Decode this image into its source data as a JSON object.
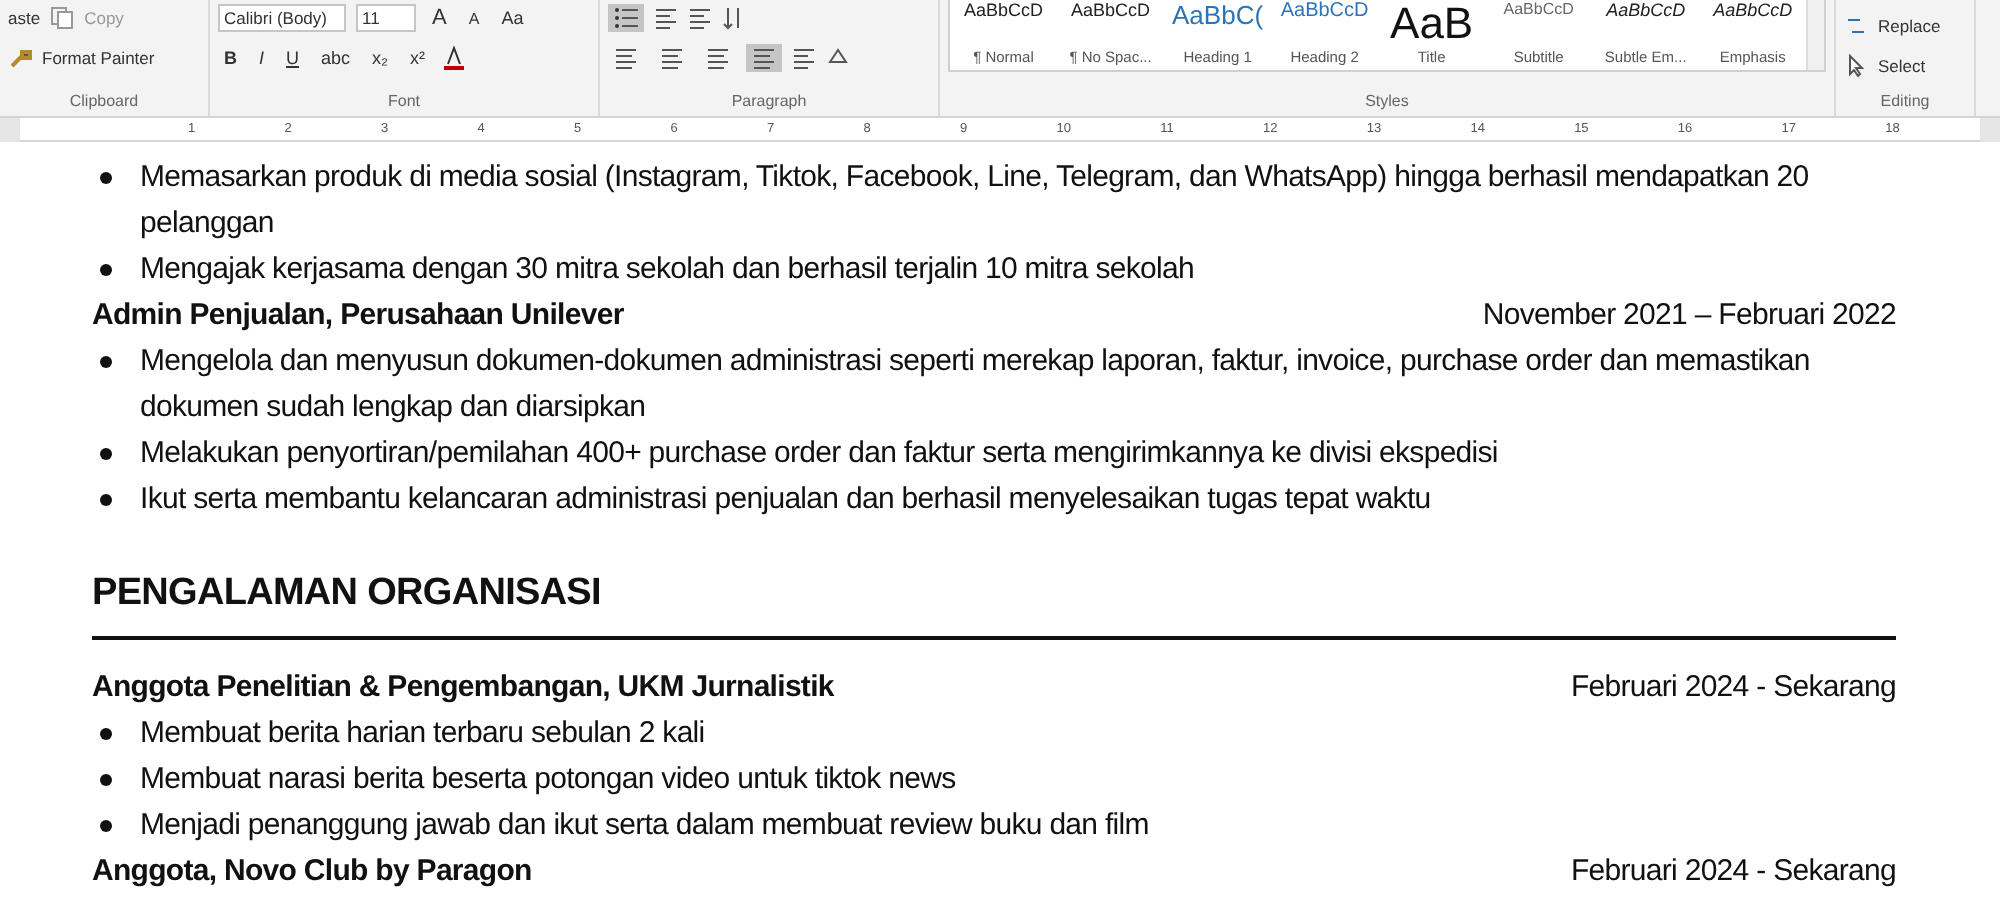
{
  "ribbon": {
    "clipboard": {
      "paste_label": "aste",
      "items": [
        "Copy",
        "Format Painter"
      ],
      "label": "Clipboard"
    },
    "font": {
      "font_name": "Calibri (Body)",
      "font_size": "11",
      "grow": "A",
      "shrink": "A",
      "case": "Aa",
      "buttons": [
        "B",
        "I",
        "U",
        "abc",
        "x₂",
        "x²"
      ],
      "label": "Font"
    },
    "paragraph": {
      "align": [
        {
          "selected": false
        },
        {
          "selected": false
        },
        {
          "selected": false
        },
        {
          "selected": true
        }
      ],
      "bullets_selected": true,
      "label": "Paragraph"
    },
    "styles": {
      "items": [
        {
          "preview": "AaBbCcD",
          "name": "¶ Normal",
          "kind": "plain"
        },
        {
          "preview": "AaBbCcD",
          "name": "¶ No Spac...",
          "kind": "plain"
        },
        {
          "preview": "AaBbC(",
          "name": "Heading 1",
          "kind": "heading1"
        },
        {
          "preview": "AaBbCcD",
          "name": "Heading 2",
          "kind": "heading2"
        },
        {
          "preview": "AaB",
          "name": "Title",
          "kind": "title"
        },
        {
          "preview": "AaBbCcD",
          "name": "Subtitle",
          "kind": "subtitle"
        },
        {
          "preview": "AaBbCcD",
          "name": "Subtle Em...",
          "kind": "italic"
        },
        {
          "preview": "AaBbCcD",
          "name": "Emphasis",
          "kind": "italic"
        }
      ],
      "label": "Styles"
    },
    "editing": {
      "items": [
        "Replace",
        "Select"
      ],
      "label": "Editing"
    }
  },
  "ruler": [
    "1",
    "2",
    "3",
    "4",
    "5",
    "6",
    "7",
    "8",
    "9",
    "10",
    "11",
    "12",
    "13",
    "14",
    "15",
    "16",
    "17",
    "18"
  ],
  "document": [
    {
      "kind": "bullet",
      "text": "Memasarkan produk di media sosial (Instagram, Tiktok, Facebook, Line, Telegram, dan WhatsApp) hingga berhasil mendapatkan 20 pelanggan"
    },
    {
      "kind": "bullet",
      "text": "Mengajak kerjasama dengan 30 mitra sekolah dan berhasil terjalin 10 mitra sekolah"
    },
    {
      "kind": "entry",
      "title": "Admin Penjualan, Perusahaan Unilever",
      "date": "November 2021 – Februari 2022"
    },
    {
      "kind": "bullet",
      "text": "Mengelola dan menyusun dokumen-dokumen administrasi seperti merekap laporan, faktur, invoice, purchase order dan memastikan dokumen sudah lengkap dan diarsipkan"
    },
    {
      "kind": "bullet",
      "text": "Melakukan penyortiran/pemilahan 400+ purchase order dan faktur serta mengirimkannya ke divisi ekspedisi"
    },
    {
      "kind": "bullet",
      "text": "Ikut serta membantu kelancaran administrasi penjualan dan berhasil menyelesaikan tugas tepat waktu"
    },
    {
      "kind": "heading",
      "text": "PENGALAMAN ORGANISASI"
    },
    {
      "kind": "entry",
      "title": "Anggota Penelitian & Pengembangan, UKM Jurnalistik",
      "date": "Februari 2024 - Sekarang"
    },
    {
      "kind": "bullet",
      "text": "Membuat berita harian terbaru sebulan 2 kali"
    },
    {
      "kind": "bullet",
      "text": "Membuat narasi berita beserta potongan video untuk tiktok news"
    },
    {
      "kind": "bullet",
      "text": "Menjadi penanggung jawab dan ikut serta dalam membuat review buku dan film"
    },
    {
      "kind": "entry",
      "title": "Anggota, Novo Club by Paragon",
      "date": "Februari 2024 - Sekarang"
    }
  ]
}
